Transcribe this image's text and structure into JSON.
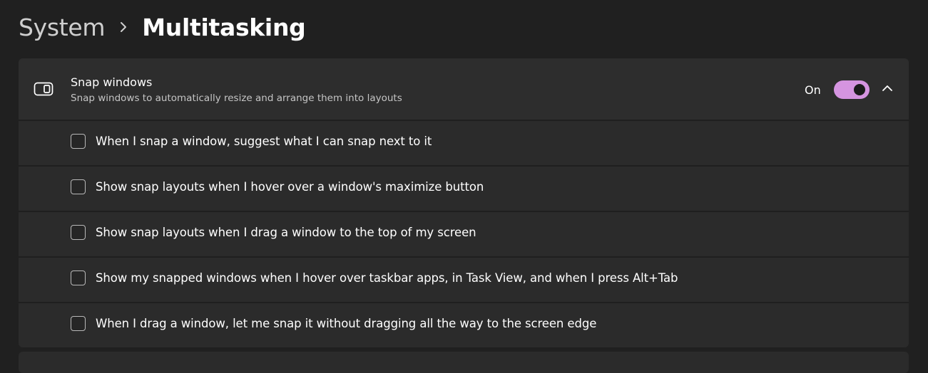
{
  "breadcrumb": {
    "parent": "System",
    "current": "Multitasking"
  },
  "snap_windows": {
    "title": "Snap windows",
    "description": "Snap windows to automatically resize and arrange them into layouts",
    "toggle_state_label": "On",
    "toggle_on": true,
    "icon": "snap-windows-icon",
    "expanded": true
  },
  "options": [
    {
      "label": "When I snap a window, suggest what I can snap next to it",
      "checked": false
    },
    {
      "label": "Show snap layouts when I hover over a window's maximize button",
      "checked": false
    },
    {
      "label": "Show snap layouts when I drag a window to the top of my screen",
      "checked": false
    },
    {
      "label": "Show my snapped windows when I hover over taskbar apps, in Task View, and when I press Alt+Tab",
      "checked": false
    },
    {
      "label": "When I drag a window, let me snap it without dragging all the way to the screen edge",
      "checked": false
    }
  ],
  "colors": {
    "background": "#202020",
    "card": "#2b2b2b",
    "accent": "#d594e0"
  }
}
